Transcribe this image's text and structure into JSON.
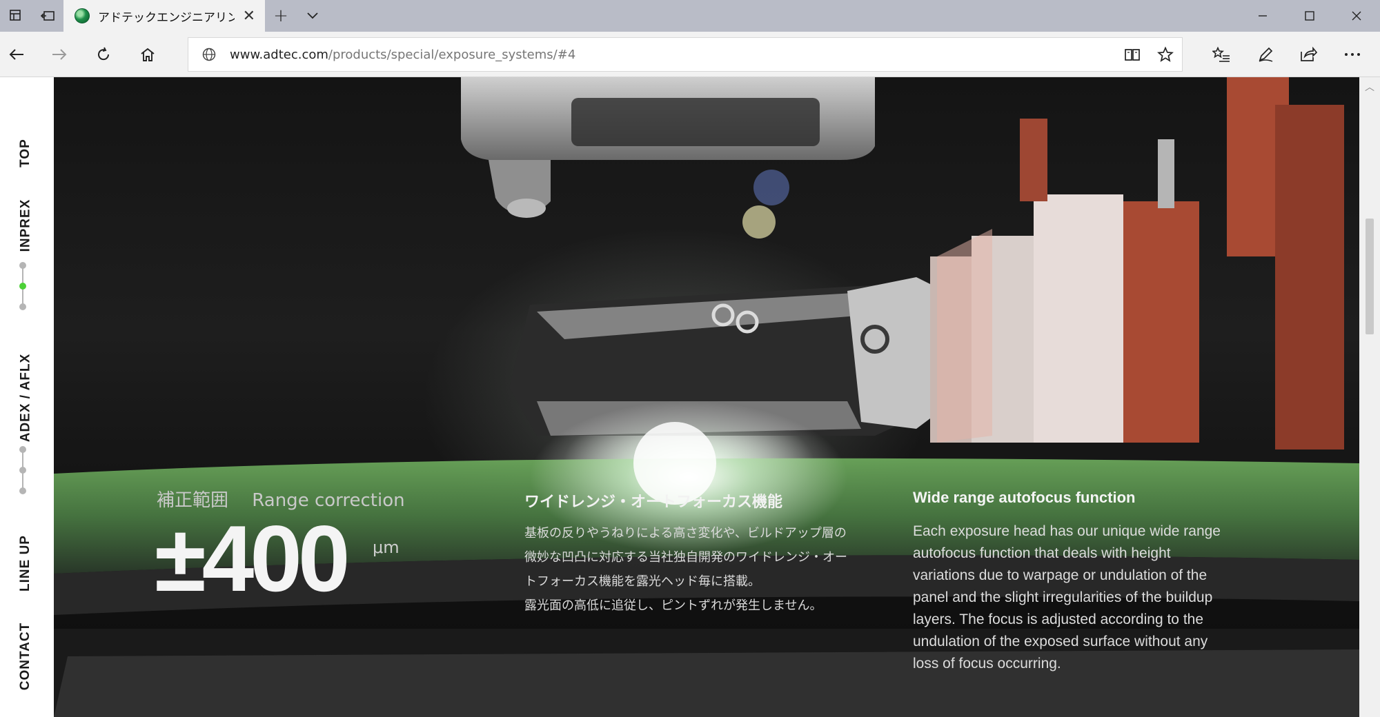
{
  "browser": {
    "tab": {
      "title": "アドテックエンジニアリング |",
      "favicon": "adtec-logo-icon"
    },
    "url": {
      "domain": "www.adtec.com",
      "path": "/products/special/exposure_systems/#4"
    },
    "icons": {
      "tab_manager": "tabs-aside-icon",
      "back_tabs": "set-aside-icon",
      "new_tab": "+",
      "tab_list": "chevron-down-icon",
      "minimize": "minimize-icon",
      "maximize": "maximize-icon",
      "close": "close-icon",
      "back": "back-arrow-icon",
      "forward": "forward-arrow-icon",
      "refresh": "refresh-icon",
      "home": "home-icon",
      "reading_view": "book-icon",
      "favorite": "star-icon",
      "favorites_hub": "favorites-list-icon",
      "notes": "pen-icon",
      "share": "share-icon",
      "more": "more-icon"
    }
  },
  "side_nav": {
    "items": [
      {
        "label": "TOP"
      },
      {
        "label": "INPREX"
      },
      {
        "label": "ADEX / AFLX"
      },
      {
        "label": "LINE UP"
      },
      {
        "label": "CONTACT"
      }
    ],
    "active_dot_color": "#4cd137"
  },
  "content": {
    "range": {
      "label_ja": "補正範囲",
      "label_en": "Range correction",
      "value": "±400",
      "unit": "μm"
    },
    "ja": {
      "heading": "ワイドレンジ・オートフォーカス機能",
      "lines": [
        "基板の反りやうねりによる高さ変化や、ビルドアップ層の",
        "微妙な凹凸に対応する当社独自開発のワイドレンジ・オー",
        "トフォーカス機能を露光ヘッド毎に搭載。",
        "露光面の高低に追従し、ピントずれが発生しません。"
      ]
    },
    "en": {
      "heading": "Wide range autofocus function",
      "lines": [
        "Each exposure head has our unique wide range",
        "autofocus function that deals with height",
        "variations due to warpage or undulation of the",
        "panel and the slight irregularities of the buildup",
        "layers. The focus is adjusted according to the",
        "undulation of the exposed surface without any",
        "loss of focus occurring."
      ]
    }
  }
}
